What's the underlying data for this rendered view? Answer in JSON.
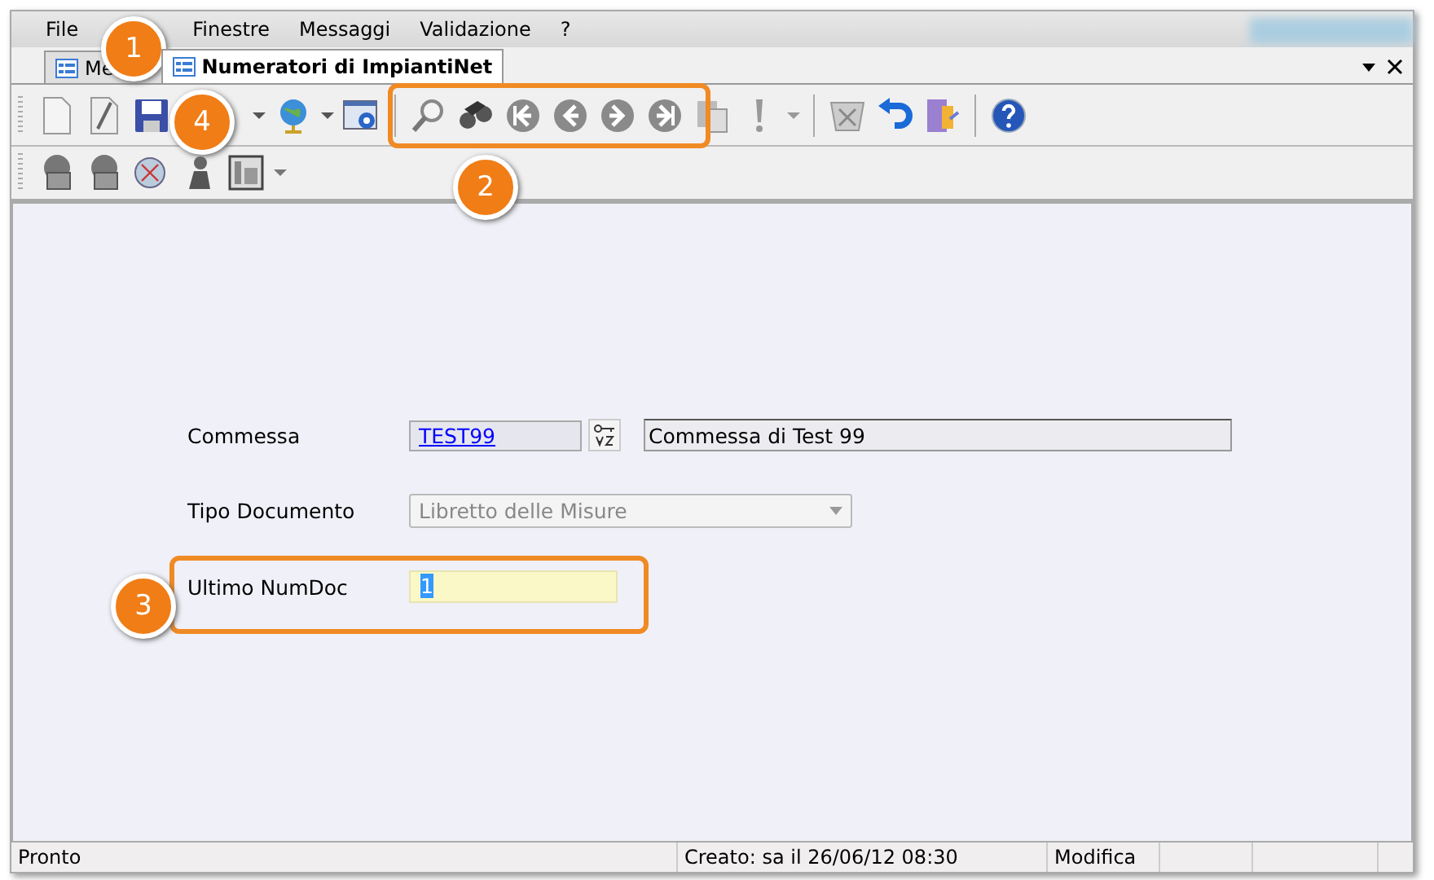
{
  "menu": [
    "File",
    "Finestre",
    "Messaggi",
    "Validazione",
    "?"
  ],
  "tabs": [
    {
      "label": "Me",
      "selected": false
    },
    {
      "label": "Numeratori di ImpiantiNet",
      "selected": true
    }
  ],
  "form": {
    "commessa": {
      "label": "Commessa",
      "code": "TEST99",
      "description": "Commessa di Test 99"
    },
    "tipo": {
      "label": "Tipo Documento",
      "value": "Libretto delle Misure",
      "disabled": true
    },
    "numdoc": {
      "label": "Ultimo NumDoc",
      "value": "1"
    }
  },
  "status_bar": [
    "Pronto",
    "Creato: sa il 26/06/12 08:30",
    "Modifica"
  ],
  "callouts": [
    "1",
    "2",
    "3",
    "4"
  ]
}
